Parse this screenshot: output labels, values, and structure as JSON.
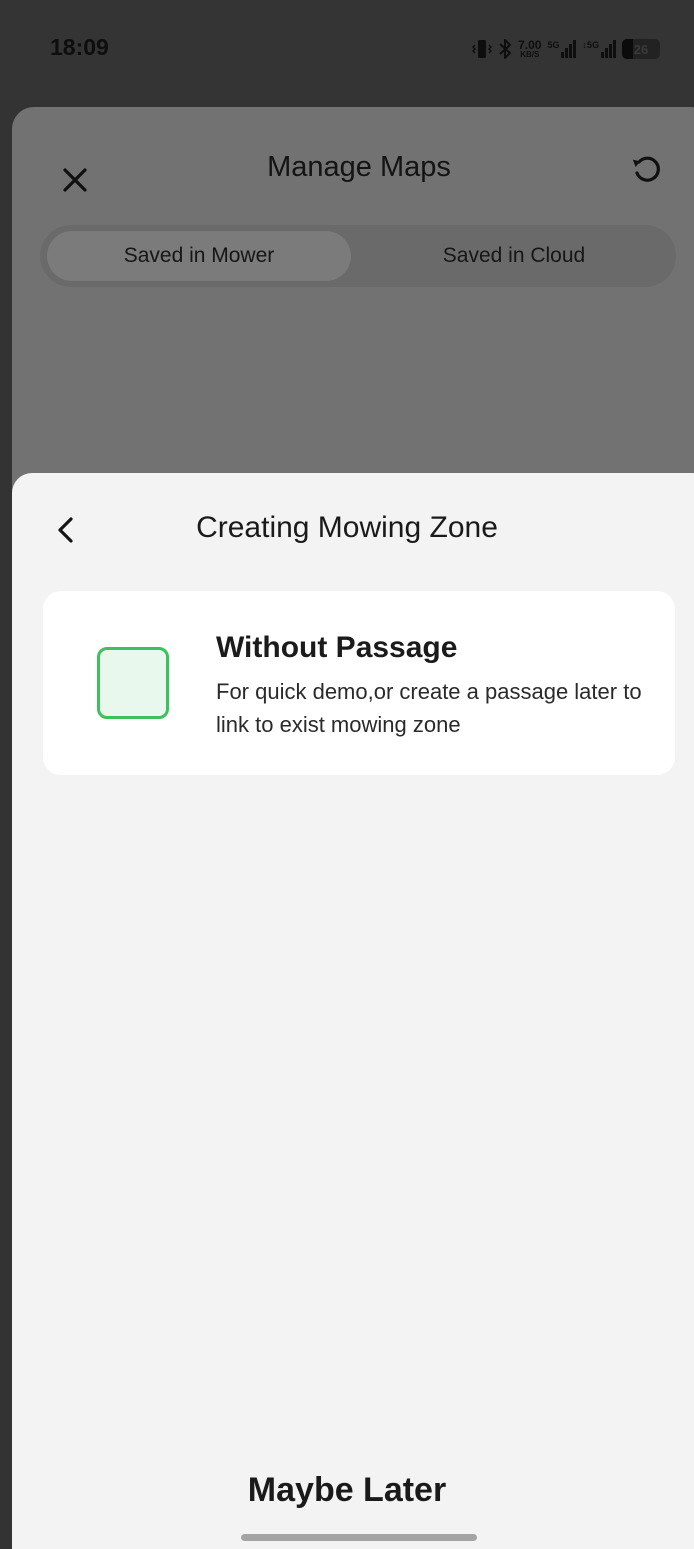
{
  "status_bar": {
    "time": "18:09",
    "network_speed": "7.00",
    "network_speed_unit": "KB/S",
    "signal1_label": "5G",
    "signal2_label": "↕5G",
    "battery": "26"
  },
  "manage_maps": {
    "title": "Manage Maps",
    "tabs": [
      {
        "label": "Saved in Mower",
        "selected": true
      },
      {
        "label": "Saved in Cloud",
        "selected": false
      }
    ]
  },
  "sheet": {
    "title": "Creating Mowing Zone",
    "option": {
      "title": "Without Passage",
      "description": "For quick demo,or create a passage later to link to exist mowing zone",
      "icon_color": "#3cc15c"
    },
    "secondary_action": "Maybe Later"
  },
  "icons": {
    "close": "close-icon",
    "refresh": "refresh-icon",
    "back": "chevron-left-icon"
  }
}
